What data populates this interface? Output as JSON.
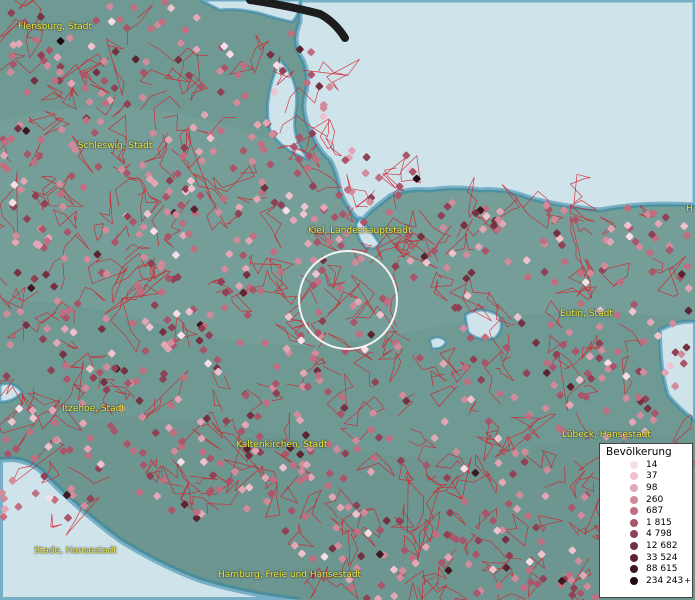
{
  "map": {
    "place_labels": [
      {
        "id": "flensburg",
        "text": "Flensburg, Stadt"
      },
      {
        "id": "schleswig",
        "text": "Schleswig, Stadt"
      },
      {
        "id": "kiel",
        "text": "Kiel, Landeshauptstadt"
      },
      {
        "id": "eutin",
        "text": "Eutin, Stadt"
      },
      {
        "id": "itzehoe",
        "text": "Itzehoe, Stadt"
      },
      {
        "id": "kaltenkirchen",
        "text": "Kaltenkirchen, Stadt"
      },
      {
        "id": "luebeck",
        "text": "Lübeck, Hansestadt"
      },
      {
        "id": "stade",
        "text": "Stade, Hansestadt"
      },
      {
        "id": "hamburg",
        "text": "Hamburg, Freie und Hansestadt"
      },
      {
        "id": "edge",
        "text": "H"
      }
    ],
    "colors": {
      "land": "#6f9a94",
      "water": "#cfe3ea",
      "coast": "#2f86a8",
      "boundaries": "#d61f2a"
    }
  },
  "legend": {
    "title": "Bevölkerung",
    "items": [
      {
        "label": "14",
        "color": "#f7dde6"
      },
      {
        "label": "37",
        "color": "#efc2ce"
      },
      {
        "label": "98",
        "color": "#e2a6b4"
      },
      {
        "label": "260",
        "color": "#d18b9a"
      },
      {
        "label": "687",
        "color": "#c06e80"
      },
      {
        "label": "1 815",
        "color": "#a9566a"
      },
      {
        "label": "4 798",
        "color": "#8f4255"
      },
      {
        "label": "12 682",
        "color": "#753242"
      },
      {
        "label": "33 524",
        "color": "#5a2431"
      },
      {
        "label": "88 615",
        "color": "#3f1720"
      },
      {
        "label": "234 243",
        "color": "#220b10",
        "suffix": "+"
      }
    ]
  }
}
